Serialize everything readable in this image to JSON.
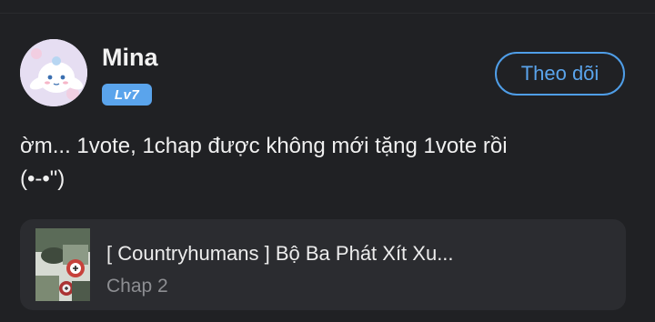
{
  "comment_item": {
    "user": {
      "name": "Mina",
      "level": "Lv7",
      "avatar_icon": "cinnamoroll-avatar-icon"
    },
    "follow_label": "Theo dõi",
    "text_line1": "ờm... 1vote, 1chap được không mới tặng 1vote rồi",
    "text_line2": "(•-•\")",
    "story": {
      "title": "[ Countryhumans ] Bộ Ba Phát Xít Xu...",
      "chapter": "Chap 2",
      "cover_icon": "story-cover-thumbnail"
    }
  },
  "colors": {
    "background": "#202124",
    "accent": "#5aa4ec",
    "card": "#2b2c30",
    "muted_text": "#8d8e92"
  }
}
